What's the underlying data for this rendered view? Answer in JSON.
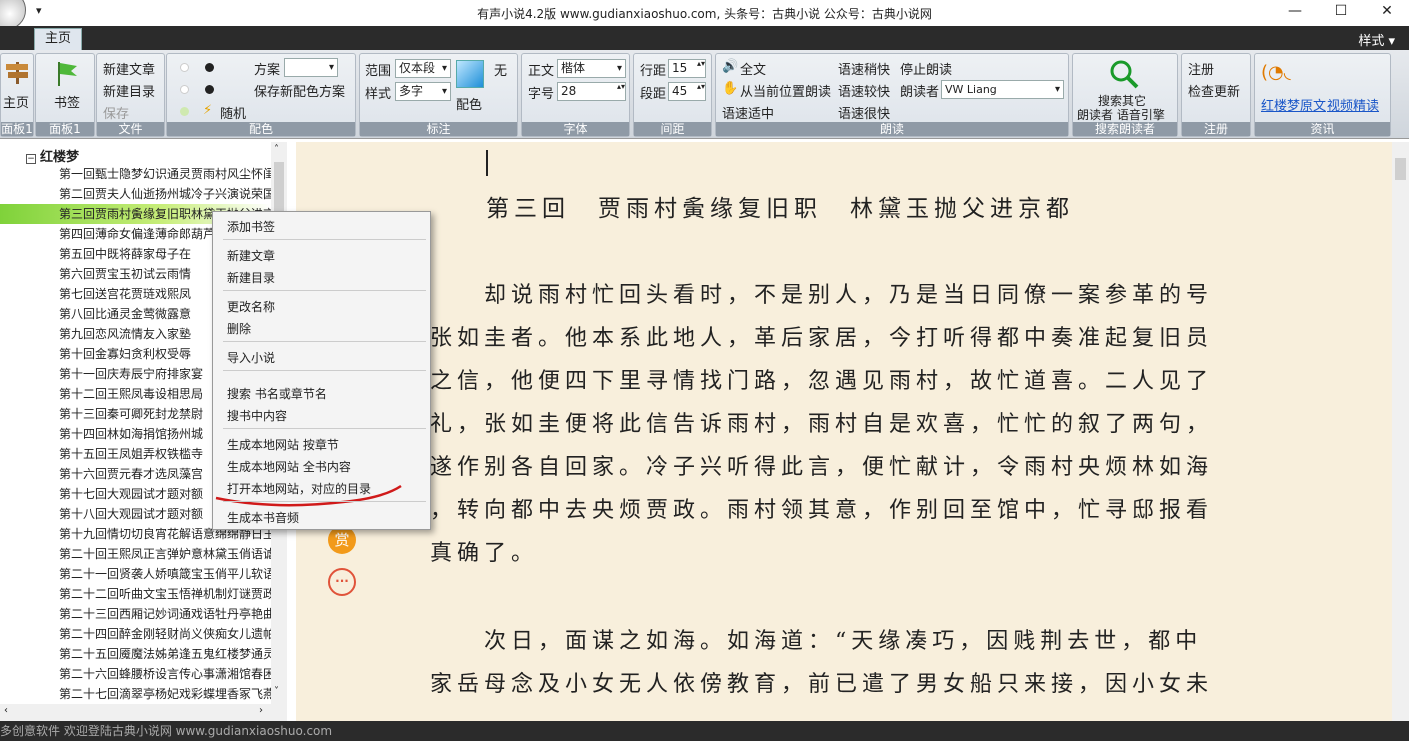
{
  "window": {
    "title": "有声小说4.2版    www.gudianxiaoshuo.com, 头条号：古典小说  公众号：古典小说网",
    "qa_arrow": "▾",
    "min": "—",
    "max": "☐",
    "close": "✕"
  },
  "tabs": {
    "home": "主页",
    "style_menu": "样式 ▾"
  },
  "ribbon": {
    "panel1": {
      "label": "主页",
      "group": "面板1"
    },
    "panel2": {
      "label": "书签",
      "group": "面板1"
    },
    "file": {
      "new_article": "新建文章",
      "new_dir": "新建目录",
      "save": "保存",
      "group": "文件"
    },
    "color": {
      "scheme": "方案",
      "save_scheme": "保存新配色方案",
      "random": "随机",
      "group": "配色"
    },
    "mark": {
      "range": "范围",
      "range_val": "仅本段",
      "style": "样式",
      "style_val": "多字",
      "none": "无",
      "color": "配色",
      "group": "标注"
    },
    "font": {
      "body": "正文",
      "body_val": "楷体",
      "size": "字号",
      "size_val": "28",
      "group": "字体"
    },
    "spacing": {
      "line": "行距",
      "line_val": "15",
      "para": "段距",
      "para_val": "45",
      "group": "间距"
    },
    "read": {
      "full": "全文",
      "from_pos": "从当前位置朗读",
      "normal": "语速适中",
      "slightly_fast": "语速稍快",
      "faster": "语速较快",
      "very_fast": "语速很快",
      "stop": "停止朗读",
      "reader": "朗读者",
      "reader_val": "VW Liang",
      "group": "朗读"
    },
    "search": {
      "label1": "搜索其它",
      "label2": "朗读者 语音引擎",
      "group": "搜索朗读者"
    },
    "register": {
      "reg": "注册",
      "update": "检查更新",
      "group": "注册"
    },
    "info": {
      "link1": "红楼梦原文",
      "link2": "视频精读",
      "group": "资讯"
    }
  },
  "sidebar": {
    "root": "红楼梦",
    "box": "−",
    "hleft": "‹",
    "hright": "›",
    "vup": "˄",
    "vdown": "˅",
    "items": [
      "第一回甄士隐梦幻识通灵贾雨村风尘怀闺秀",
      "第二回贾夫人仙逝扬州城冷子兴演说荣国府",
      "第三回贾雨村夤缘复旧职林黛玉抛父进京都",
      "第四回薄命女偏逢薄命郎葫芦僧乱判葫芦案",
      "第五回中既将薛家母子在",
      "第六回贾宝玉初试云雨情",
      "第七回送宫花贾琏戏熙凤",
      "第八回比通灵金莺微露意",
      "第九回恋风流情友入家塾",
      "第十回金寡妇贪利权受辱",
      "第十一回庆寿辰宁府排家宴",
      "第十二回王熙凤毒设相思局",
      "第十三回秦可卿死封龙禁尉",
      "第十四回林如海捐馆扬州城",
      "第十五回王凤姐弄权铁槛寺",
      "第十六回贾元春才选凤藻宫",
      "第十七回大观园试才题对额",
      "第十八回大观园试才题对额",
      "第十九回情切切良宵花解语意绵绵静日玉生香",
      "第二十回王熙凤正言弹妒意林黛玉俏语谑娇音",
      "第二十一回贤袭人娇嗔箴宝玉俏平儿软语救贾琏",
      "第二十二回听曲文宝玉悟禅机制灯谜贾政悲谶语",
      "第二十三回西厢记妙词通戏语牡丹亭艳曲警芳心",
      "第二十四回醉金刚轻财尚义侠痴女儿遗帕惹相思",
      "第二十五回魇魔法姊弟逢五鬼红楼梦通灵遇双真",
      "第二十六回蜂腰桥设言传心事潇湘馆春困发幽情",
      "第二十七回滴翠亭杨妃戏彩蝶埋香冢飞燕泣残红"
    ]
  },
  "menu": {
    "items": [
      "添加书签",
      "新建文章",
      "新建目录",
      "更改名称",
      "删除",
      "导入小说",
      "搜索 书名或章节名",
      "搜书中内容",
      "生成本地网站 按章节",
      "生成本地网站 全书内容",
      "打开本地网站，对应的目录",
      "生成本书音频"
    ]
  },
  "content": {
    "title": "第三回　贾雨村夤缘复旧职　林黛玉抛父进京都",
    "p1": [
      "　　却说雨村忙回头看时，不是别人，乃是当日同僚一案参革的号",
      "张如圭者。他本系此地人，革后家居，今打听得都中奏准起复旧员",
      "之信，他便四下里寻情找门路，忽遇见雨村，故忙道喜。二人见了",
      "礼，张如圭便将此信告诉雨村，雨村自是欢喜，忙忙的叙了两句，",
      "遂作别各自回家。冷子兴听得此言，便忙献计，令雨村央烦林如海",
      "，转向都中去央烦贾政。雨村领其意，作别回至馆中，忙寻邸报看",
      "真确了。"
    ],
    "p2": [
      "　　次日，面谋之如海。如海道：“天缘凑巧，因贱荆去世，都中",
      "家岳母念及小女无人依傍教育，前已遣了男女船只来接，因小女未"
    ],
    "reward": "赏",
    "more": "···"
  },
  "status": "多创意软件 欢迎登陆古典小说网  www.gudianxiaoshuo.com"
}
